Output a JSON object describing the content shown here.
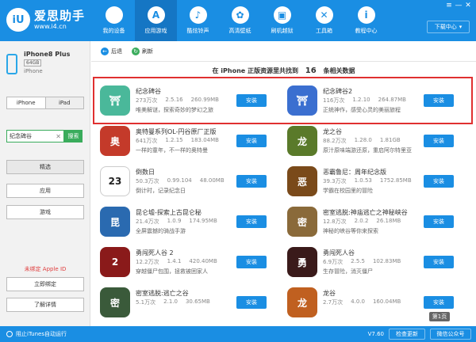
{
  "app": {
    "name": "爱思助手",
    "url": "www.i4.cn",
    "logo_text": "iU",
    "accent_color": "#1a8ee3"
  },
  "window": {
    "download_center": "下载中心",
    "controls": [
      "≡",
      "—",
      "✕"
    ]
  },
  "nav": [
    {
      "label": "我的设备",
      "icon": "apple-icon",
      "glyph": "",
      "active": false
    },
    {
      "label": "应用游戏",
      "icon": "appstore-icon",
      "glyph": "A",
      "active": true
    },
    {
      "label": "酷炫铃声",
      "icon": "bell-icon",
      "glyph": "♪",
      "active": false
    },
    {
      "label": "高清壁纸",
      "icon": "flower-icon",
      "glyph": "✿",
      "active": false
    },
    {
      "label": "刷机越狱",
      "icon": "box-icon",
      "glyph": "▣",
      "active": false
    },
    {
      "label": "工具箱",
      "icon": "tools-icon",
      "glyph": "✕",
      "active": false
    },
    {
      "label": "教程中心",
      "icon": "info-icon",
      "glyph": "i",
      "active": false
    }
  ],
  "device": {
    "name": "iPhone8 Plus",
    "capacity": "64GB",
    "type": "iPhone"
  },
  "sidebar": {
    "seg_iphone": "iPhone",
    "seg_ipad": "iPad",
    "search_value": "纪念碑谷",
    "search_btn": "搜索",
    "categories": [
      "精选",
      "应用",
      "游戏"
    ],
    "unbound": "未绑定 Apple ID",
    "bind_btn": "立即绑定",
    "learn_btn": "了解详情"
  },
  "toolbar": {
    "back": "后退",
    "refresh": "刷新"
  },
  "results": {
    "prefix": "在 iPhone 正版资源里共找到",
    "count": "16",
    "suffix": "条相关数据"
  },
  "install_label": "安装",
  "apps": [
    {
      "title": "纪念碑谷",
      "downloads": "273万次",
      "version": "2.5.16",
      "size": "260.99MB",
      "desc": "唯美解谜，探索奇妙的梦幻之旅",
      "color": "#4ab89a",
      "glyph": "⛩"
    },
    {
      "title": "纪念碑谷2",
      "downloads": "116万次",
      "version": "1.2.10",
      "size": "264.87MB",
      "desc": "正统神作，感受心灵的美丽旅程",
      "color": "#3b6fd0",
      "glyph": "⛩"
    },
    {
      "title": "奥特曼系列OL-円谷原厂正版",
      "downloads": "641万次",
      "version": "1.2.15",
      "size": "183.04MB",
      "desc": "一样的童年，不一样的奥特曼",
      "color": "#c43a2a",
      "glyph": "奥"
    },
    {
      "title": "龙之谷",
      "downloads": "88.2万次",
      "version": "1.28.0",
      "size": "1.81GB",
      "desc": "原汁原味端游还原，重启阿尔特里亚",
      "color": "#5a7a2a",
      "glyph": "龙"
    },
    {
      "title": "倒数日",
      "downloads": "50.3万次",
      "version": "0.99.104",
      "size": "48.00MB",
      "desc": "倒计时，记录纪念日",
      "color": "#ffffff",
      "glyph": "23"
    },
    {
      "title": "恶霸鲁尼：周年纪念版",
      "downloads": "39.3万次",
      "version": "1.0.53",
      "size": "1752.85MB",
      "desc": "学霸在校园里的冒险",
      "color": "#7a4a1a",
      "glyph": "恶"
    },
    {
      "title": "昆仑墟-探索上古昆仑秘",
      "downloads": "21.4万次",
      "version": "1.0.9",
      "size": "174.95MB",
      "desc": "全屏震撼的骑战手游",
      "color": "#2a6ab0",
      "glyph": "昆"
    },
    {
      "title": "密室逃脱:神庙逃亡之神秘峡谷",
      "downloads": "12.8万次",
      "version": "2.0.2",
      "size": "26.18MB",
      "desc": "神秘的峡谷等你来探索",
      "color": "#8a6a3a",
      "glyph": "密"
    },
    {
      "title": "勇闯死人谷 2",
      "downloads": "12.2万次",
      "version": "1.4.1",
      "size": "420.40MB",
      "desc": "穿越僵尸包围，拯救被困家人",
      "color": "#8a1a1a",
      "glyph": "2"
    },
    {
      "title": "勇闯死人谷",
      "downloads": "6.9万次",
      "version": "2.5.5",
      "size": "102.83MB",
      "desc": "生存冒险，消灭僵尸",
      "color": "#3a1a1a",
      "glyph": "勇"
    },
    {
      "title": "密室逃脱:逃亡之谷",
      "downloads": "5.1万次",
      "version": "2.1.0",
      "size": "30.65MB",
      "desc": "",
      "color": "#3a5a3a",
      "glyph": "密"
    },
    {
      "title": "龙谷",
      "downloads": "2.7万次",
      "version": "4.0.0",
      "size": "160.04MB",
      "desc": "",
      "color": "#c06020",
      "glyph": "龙"
    }
  ],
  "page_badge": "第1页",
  "footer": {
    "itunes": "阻止iTunes自动运行",
    "version": "V7.60",
    "check_update": "检查更新",
    "wechat": "微信公众号"
  }
}
